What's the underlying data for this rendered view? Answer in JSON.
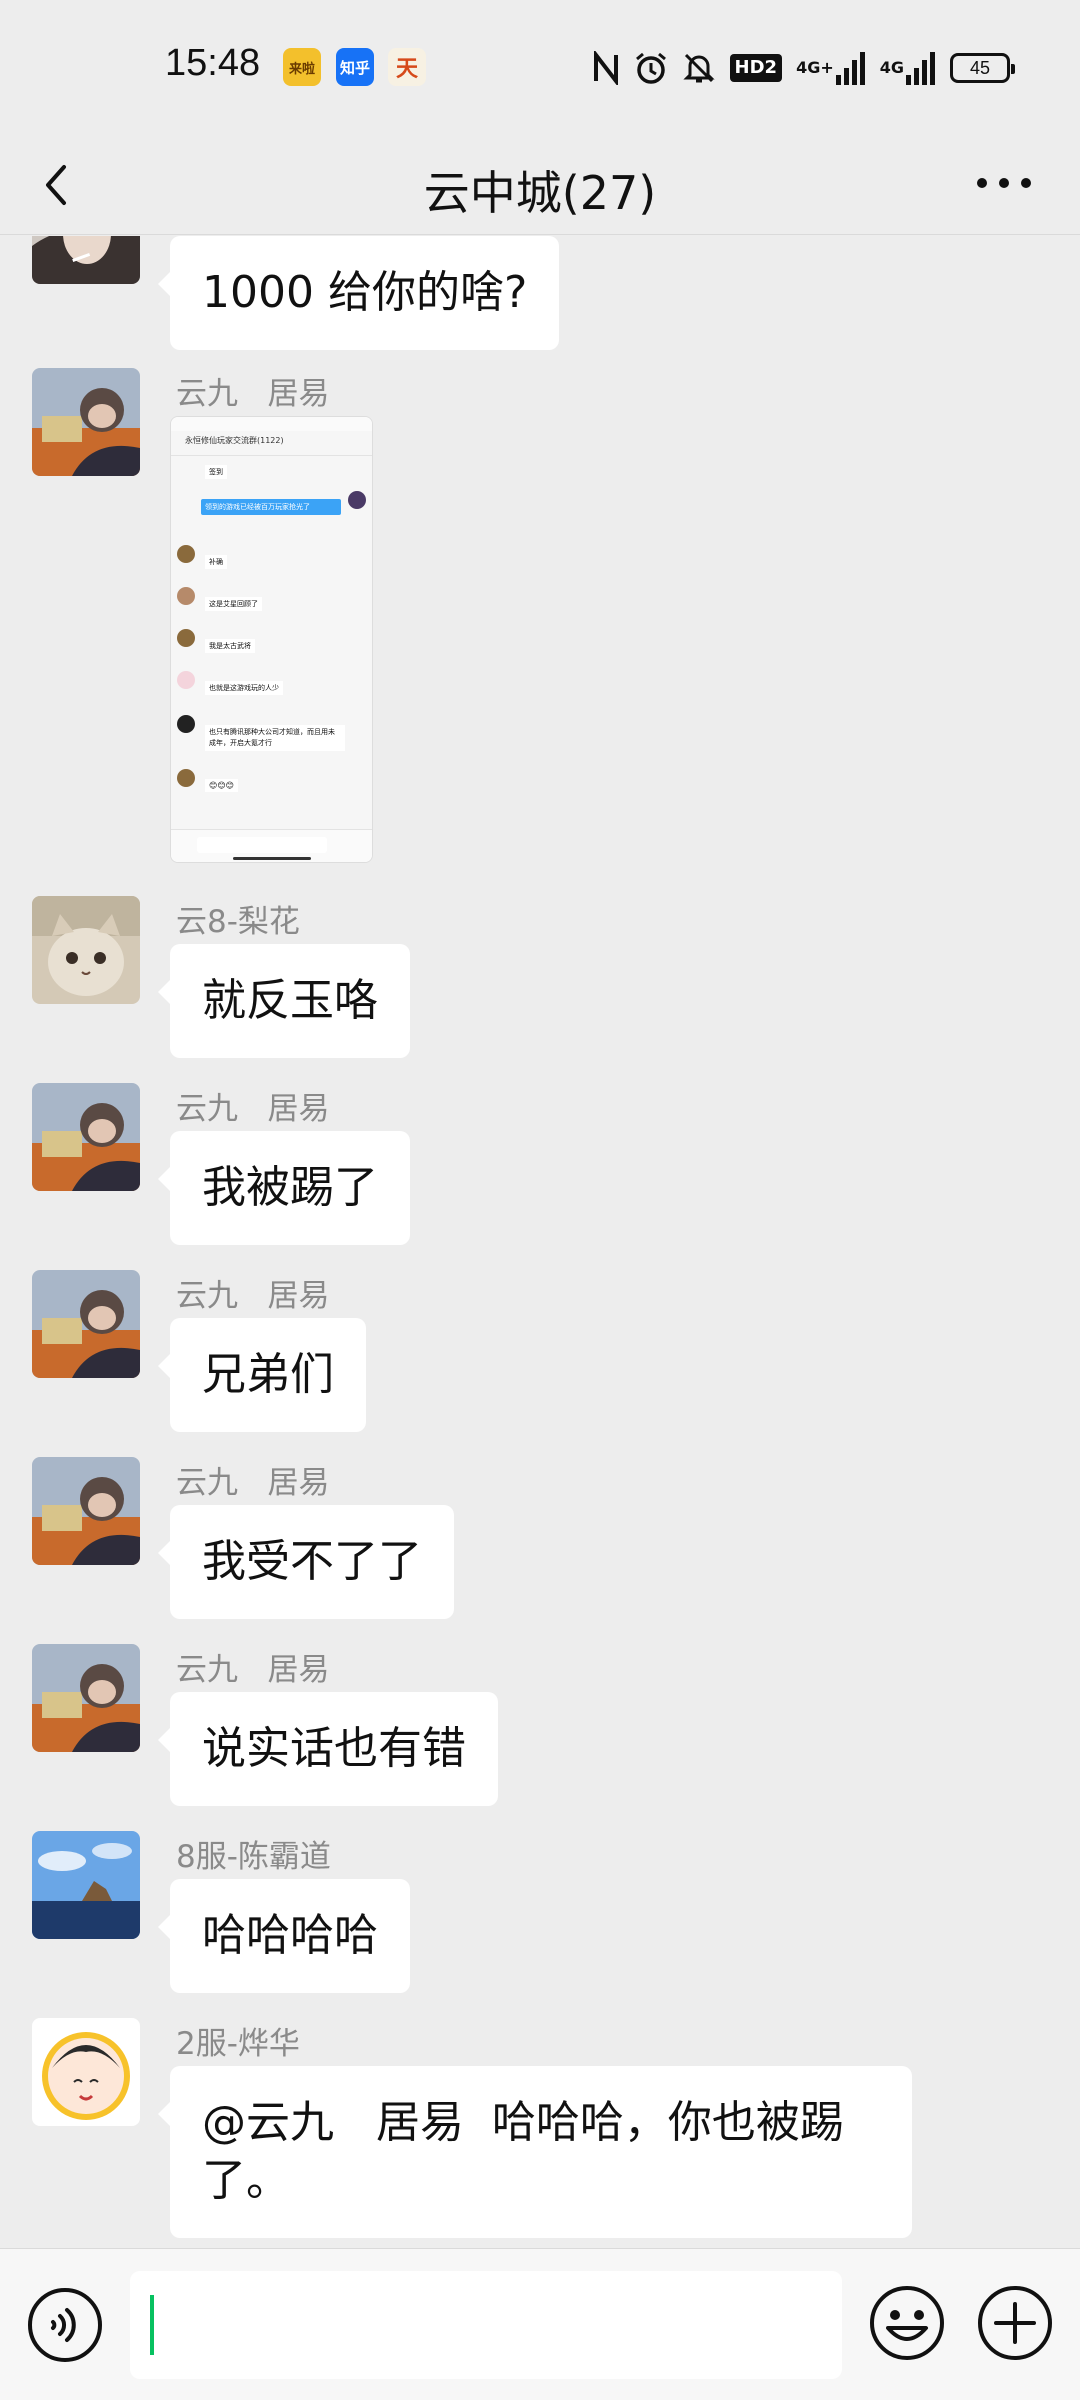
{
  "status_bar": {
    "time": "15:48",
    "notification_apps": [
      "来啦",
      "知乎",
      "天"
    ],
    "hd_label": "HD2",
    "network_1": "4G+",
    "network_2": "4G",
    "battery": "45"
  },
  "header": {
    "title": "云中城(27)"
  },
  "messages": [
    {
      "sender": "",
      "text": "1000 给你的啥?"
    },
    {
      "sender": "云九   居易",
      "type": "image"
    },
    {
      "sender": "云8-梨花",
      "text": "就反玉咯"
    },
    {
      "sender": "云九   居易",
      "text": "我被踢了"
    },
    {
      "sender": "云九   居易",
      "text": "兄弟们"
    },
    {
      "sender": "云九   居易",
      "text": "我受不了了"
    },
    {
      "sender": "云九   居易",
      "text": "说实话也有错"
    },
    {
      "sender": "8服-陈霸道",
      "text": "哈哈哈哈"
    },
    {
      "sender": "2服-烨华",
      "text": "@云九   居易  哈哈哈，你也被踢\n了。"
    }
  ],
  "screenshot_thumb": {
    "title": "永恒修仙玩家交流群(1122)",
    "lines": [
      "签到",
      "领到的游戏已经被百万玩家抢光了",
      "补确",
      "这是艾星回顾了",
      "我是太古武将",
      "也就是这游戏玩的人少",
      "也只有腾讯那种大公司才知道，而且用未成年，开启大氪才行",
      "😊😊😊"
    ]
  },
  "input": {
    "value": ""
  },
  "colors": {
    "background": "#ededed",
    "bubble": "#ffffff",
    "accent": "#07c160"
  }
}
